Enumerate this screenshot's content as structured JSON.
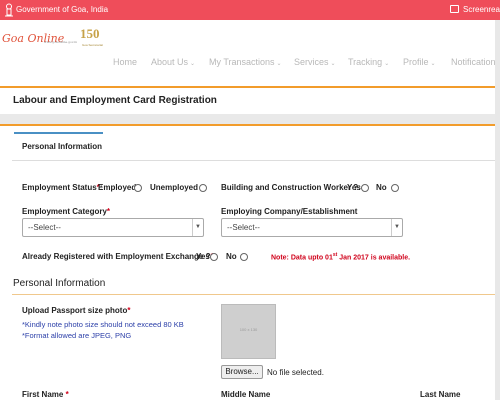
{
  "gov_bar": {
    "title": "Government of Goa, India",
    "screenreader_label": "Screenreade"
  },
  "header": {
    "logo_text": "Goa Online",
    "logo_subtitle": "www.goaonline.gov.in",
    "anniversary_number": "150",
    "anniversary_tagline": "Goa Secretariat",
    "nav": [
      "Home",
      "About Us",
      "My Transactions",
      "Services",
      "Tracking",
      "Profile",
      "Notification"
    ]
  },
  "page": {
    "title": "Labour and Employment Card Registration"
  },
  "tab": {
    "label": "Personal Information"
  },
  "employment_status": {
    "label": "Employment Status",
    "required_mark": "*",
    "suffix": ":",
    "options": [
      "Employed",
      "Unemployed"
    ]
  },
  "bcw": {
    "label": "Building and Construction Worker ?:",
    "options": [
      "Yes",
      "No"
    ]
  },
  "employment_category": {
    "label": "Employment Category",
    "required_mark": "*",
    "value": "--Select--"
  },
  "employing_company": {
    "label": "Employing Company/Establishment",
    "value": "--Select--"
  },
  "already_registered": {
    "label": "Already Registered with Employment Exchange ?",
    "required_mark": "*",
    "suffix": ":",
    "options": [
      "Yes",
      "No"
    ]
  },
  "note": {
    "prefix": "Note: Data upto 01",
    "sup": "st",
    "suffix": " Jan 2017 is available."
  },
  "personal_section": {
    "heading": "Personal Information"
  },
  "photo_upload": {
    "label": "Upload Passport size photo",
    "required_mark": "*",
    "hint1": "*Kindly note photo size should not exceed 80 KB",
    "hint2": "*Format allowed are JPEG, PNG",
    "placeholder": "100 x 130",
    "browse_label": "Browse...",
    "file_status": "No file selected."
  },
  "name_fields": {
    "first_label": "First Name",
    "first_required": "*",
    "middle_label": "Middle Name",
    "last_label": "Last Name"
  },
  "colors": {
    "gov_bar": "#ef4d5a",
    "accent_orange": "#f29c2b",
    "tab_blue": "#4a90c4",
    "required_red": "#d0021b",
    "hint_blue": "#2b3fa8"
  }
}
